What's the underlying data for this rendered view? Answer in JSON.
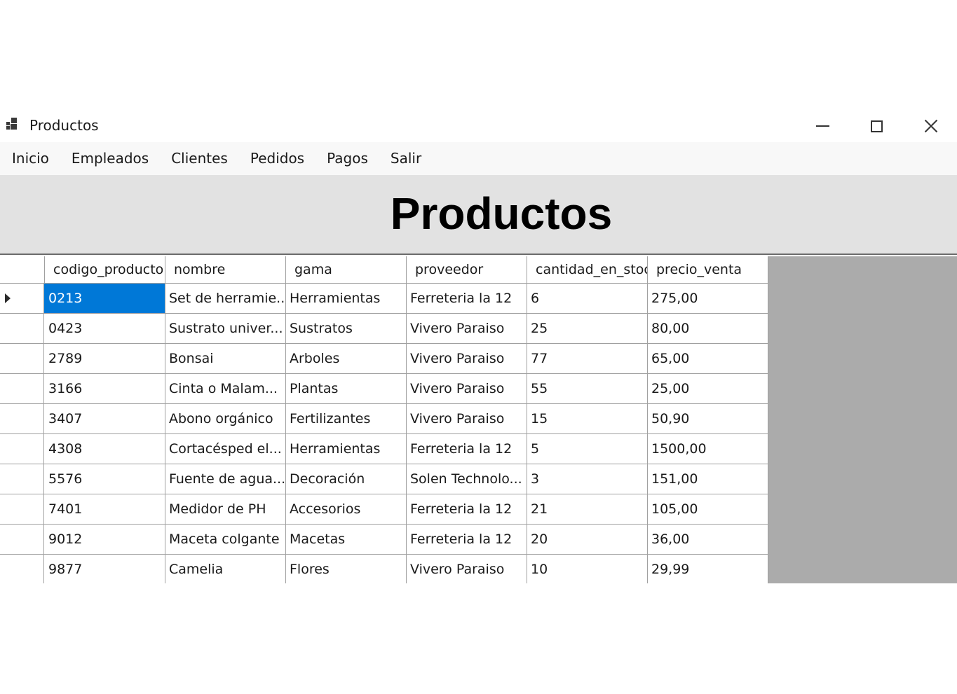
{
  "window": {
    "title": "Productos",
    "icon": "app-window-icon",
    "controls": {
      "minimize": "minimize-icon",
      "maximize": "maximize-icon",
      "close": "close-icon"
    }
  },
  "menu": {
    "items": [
      "Inicio",
      "Empleados",
      "Clientes",
      "Pedidos",
      "Pagos",
      "Salir"
    ]
  },
  "header": {
    "title": "Productos"
  },
  "table": {
    "columns": [
      "codigo_producto",
      "nombre",
      "gama",
      "proveedor",
      "cantidad_en_stoc",
      "precio_venta"
    ],
    "selected_row": 0,
    "selected_col": 0,
    "rows": [
      [
        "0213",
        "Set de herramie...",
        "Herramientas",
        "Ferreteria la 12",
        "6",
        "275,00"
      ],
      [
        "0423",
        "Sustrato univer...",
        "Sustratos",
        "Vivero Paraiso",
        "25",
        "80,00"
      ],
      [
        "2789",
        "Bonsai",
        "Arboles",
        "Vivero Paraiso",
        "77",
        "65,00"
      ],
      [
        "3166",
        "Cinta o Malam...",
        "Plantas",
        "Vivero Paraiso",
        "55",
        "25,00"
      ],
      [
        "3407",
        "Abono orgánico",
        "Fertilizantes",
        "Vivero Paraiso",
        "15",
        "50,90"
      ],
      [
        "4308",
        "Cortacésped el...",
        "Herramientas",
        "Ferreteria la 12",
        "5",
        "1500,00"
      ],
      [
        "5576",
        "Fuente de agua...",
        "Decoración",
        "Solen Technolo...",
        "3",
        "151,00"
      ],
      [
        "7401",
        "Medidor de PH",
        "Accesorios",
        "Ferreteria la 12",
        "21",
        "105,00"
      ],
      [
        "9012",
        "Maceta colgante",
        "Macetas",
        "Ferreteria la 12",
        "20",
        "36,00"
      ],
      [
        "9877",
        "Camelia",
        "Flores",
        "Vivero Paraiso",
        "10",
        "29,99"
      ]
    ]
  },
  "colors": {
    "selection": "#0078d7",
    "grid_background": "#ababab",
    "header_panel": "#e2e2e2"
  }
}
